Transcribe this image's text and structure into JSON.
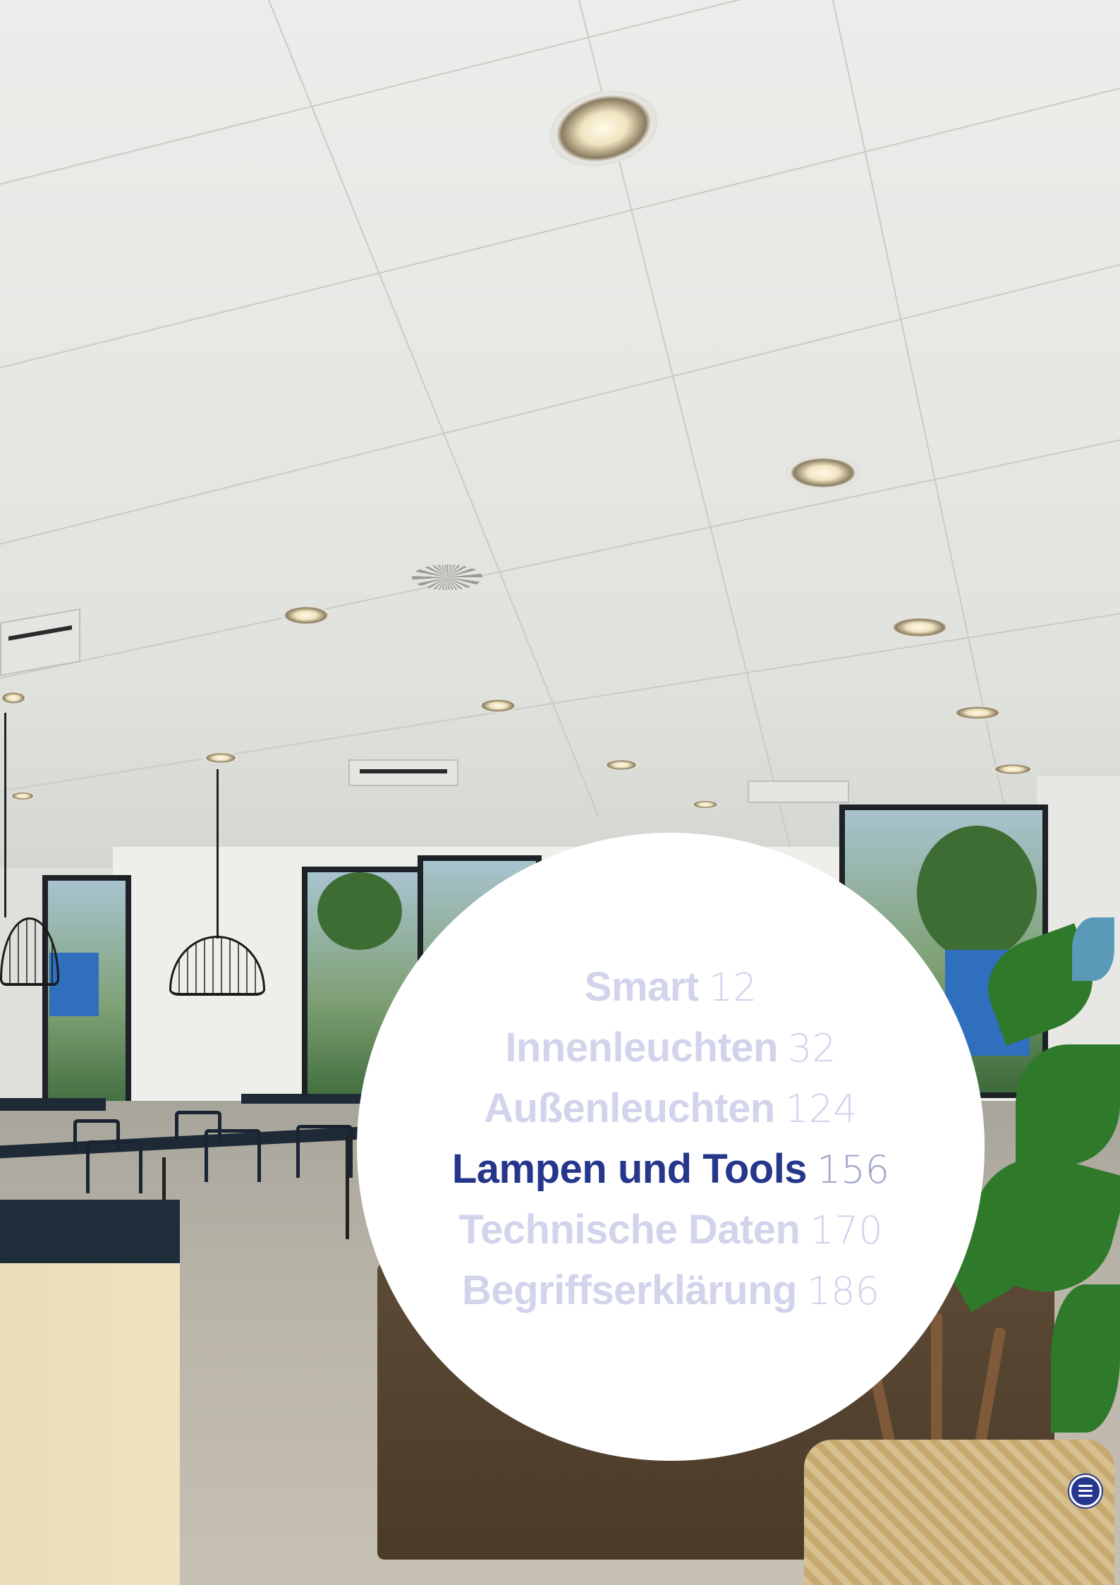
{
  "toc": {
    "items": [
      {
        "label": "Smart",
        "page": "12",
        "active": false
      },
      {
        "label": "Innenleuchten",
        "page": "32",
        "active": false
      },
      {
        "label": "Außenleuchten",
        "page": "124",
        "active": false
      },
      {
        "label": "Lampen und Tools",
        "page": "156",
        "active": true
      },
      {
        "label": "Technische Daten",
        "page": "170",
        "active": false
      },
      {
        "label": "Begriffserklärung",
        "page": "186",
        "active": false
      }
    ]
  },
  "colors": {
    "active_label": "#26368a",
    "inactive_label": "#d2d4ec",
    "menu_button": "#27378e"
  },
  "menu_button": {
    "icon": "hamburger-menu-icon"
  }
}
